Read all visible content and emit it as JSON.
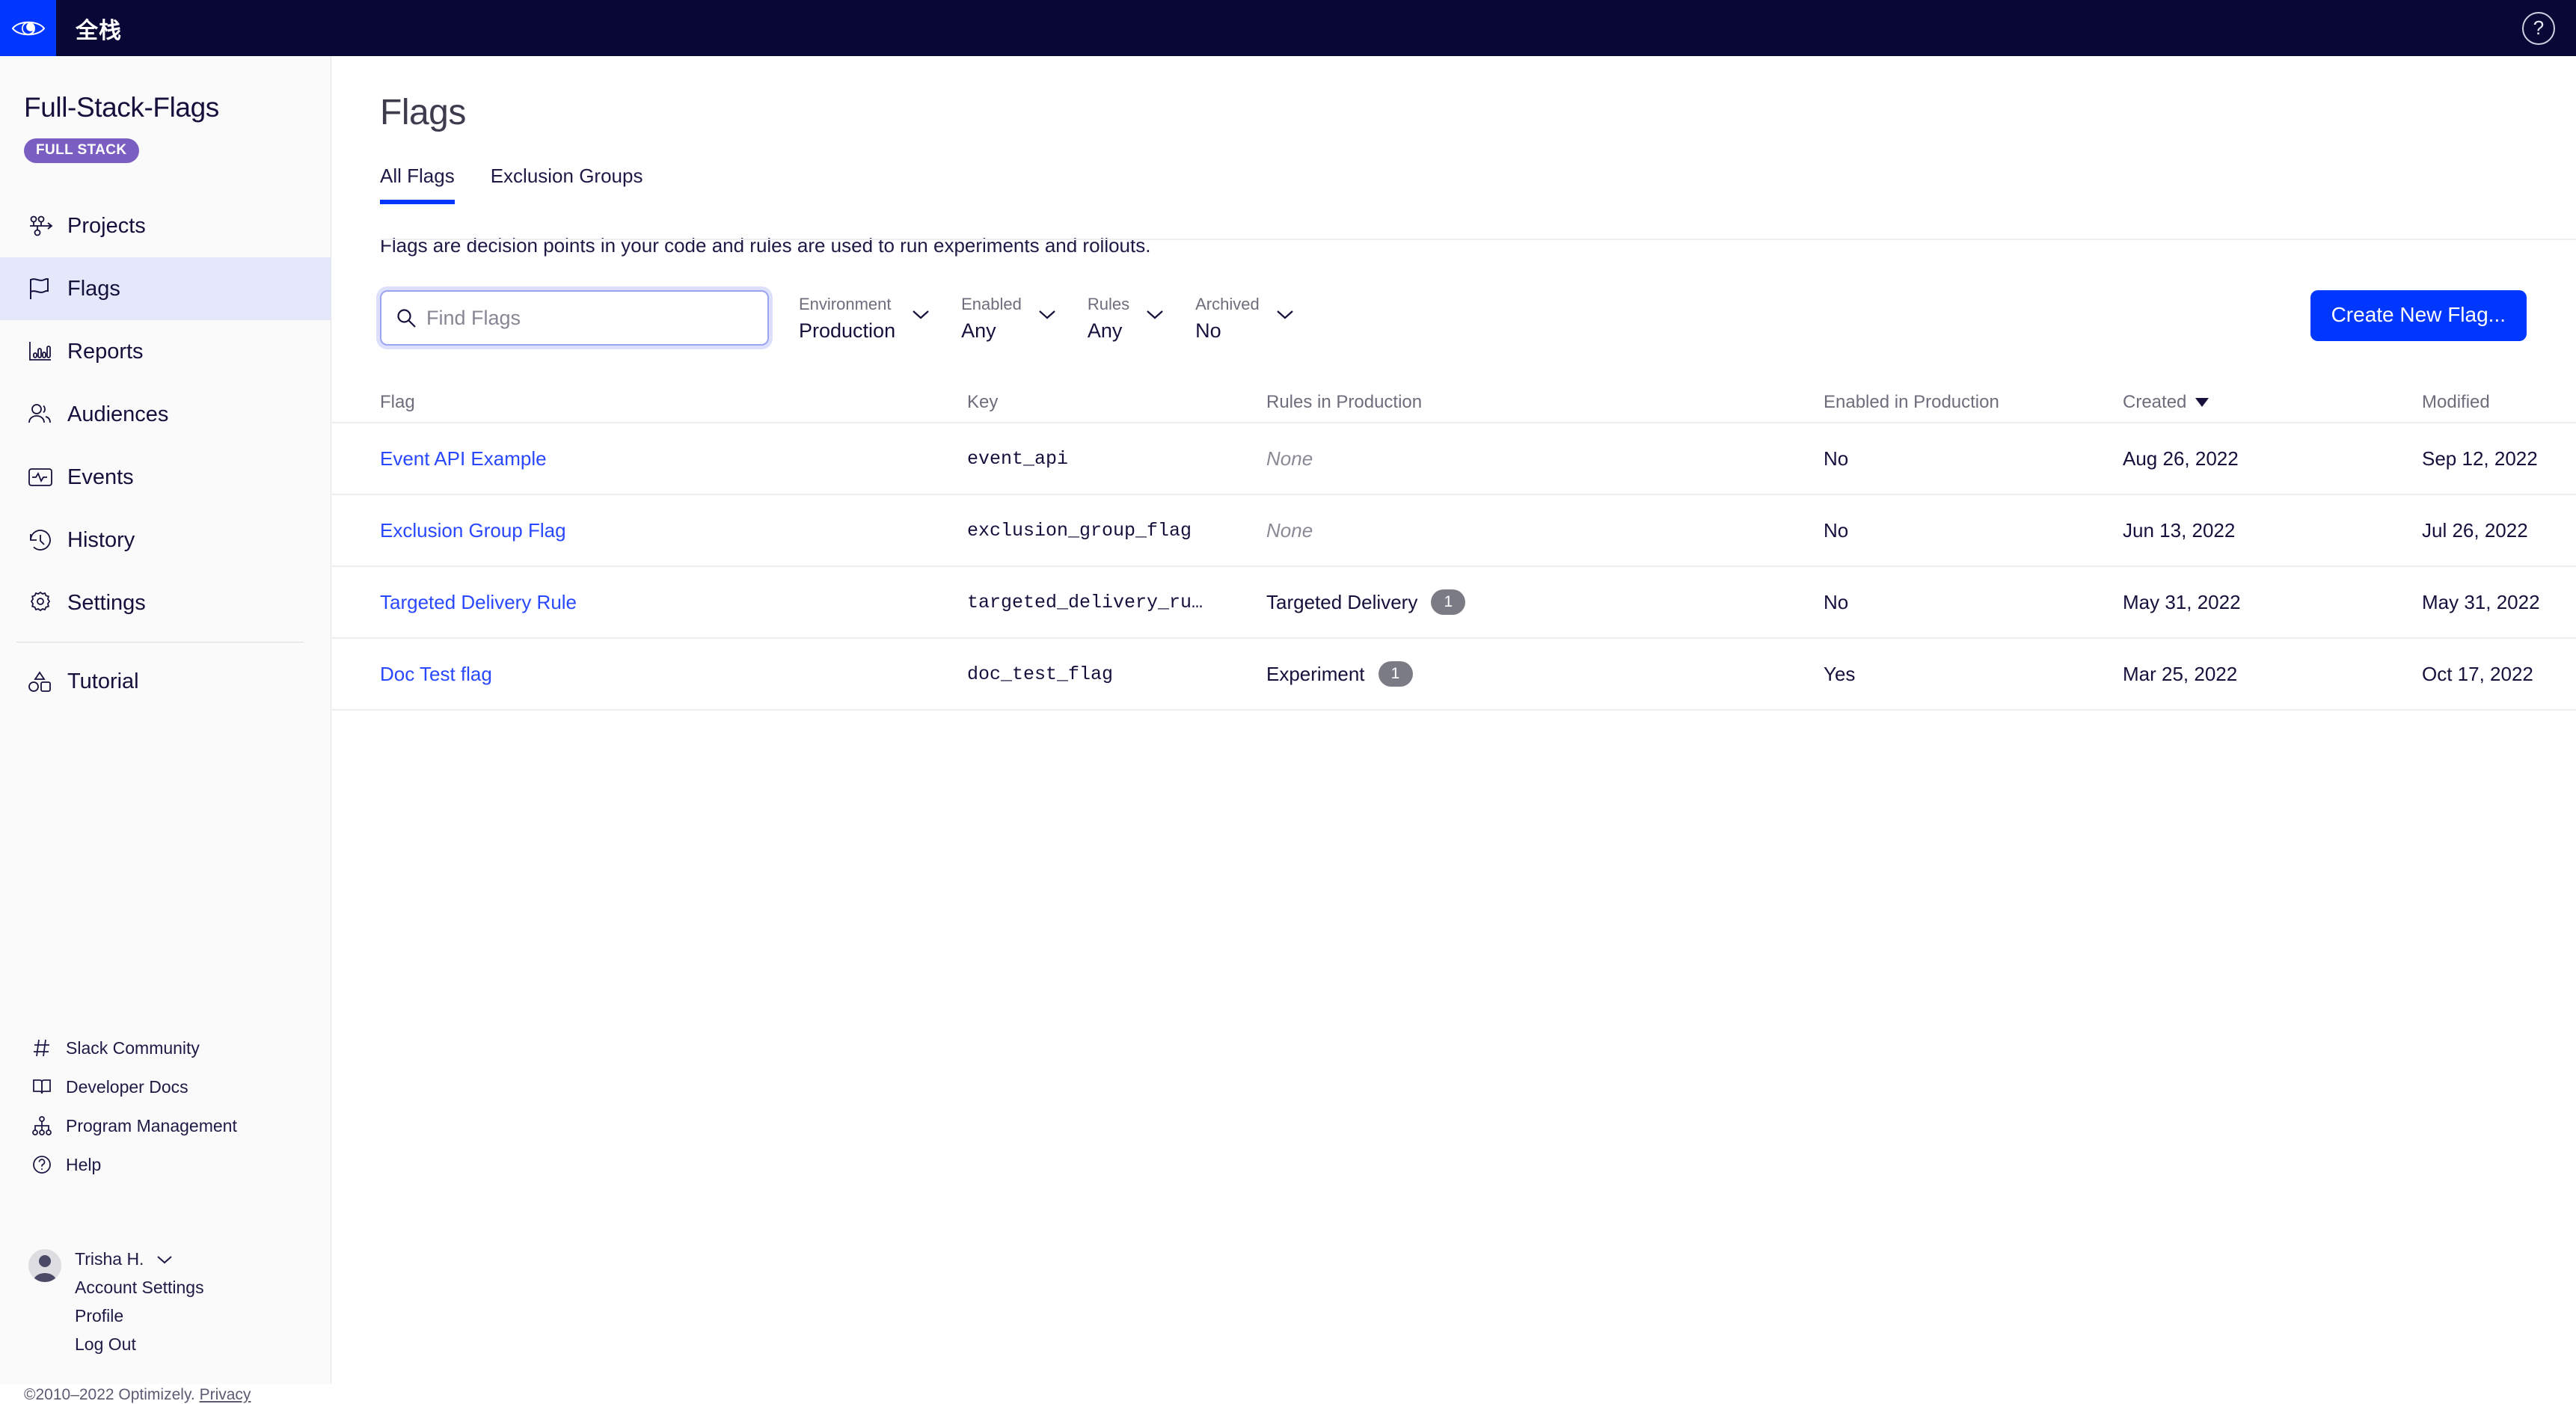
{
  "topbar": {
    "title": "全栈",
    "logo_icon": "optimizely-eye-icon",
    "help_icon": "question-mark-circle-icon",
    "bg_color": "#080736",
    "logo_tile_color": "#0037ff"
  },
  "sidebar": {
    "project_name": "Full-Stack-Flags",
    "project_badge": "FULL STACK",
    "badge_color": "#7b5ec1",
    "nav_items": [
      {
        "label": "Projects",
        "icon": "projects-node-tree-icon",
        "active": false
      },
      {
        "label": "Flags",
        "icon": "flag-icon",
        "active": true
      },
      {
        "label": "Reports",
        "icon": "bar-chart-icon",
        "active": false
      },
      {
        "label": "Audiences",
        "icon": "people-icon",
        "active": false
      },
      {
        "label": "Events",
        "icon": "monitor-pulse-icon",
        "active": false
      },
      {
        "label": "History",
        "icon": "clock-rewind-icon",
        "active": false
      },
      {
        "label": "Settings",
        "icon": "gear-icon",
        "active": false
      },
      {
        "label": "Tutorial",
        "icon": "shapes-icon",
        "active": false
      }
    ],
    "active_bg": "#e5e8fb",
    "footer_items": [
      {
        "label": "Slack Community",
        "icon": "hash-icon"
      },
      {
        "label": "Developer Docs",
        "icon": "book-icon"
      },
      {
        "label": "Program Management",
        "icon": "org-chart-icon"
      },
      {
        "label": "Help",
        "icon": "question-mark-circle-icon"
      }
    ],
    "user": {
      "name": "Trisha H.",
      "avatar_icon": "user-avatar-icon",
      "chevron_icon": "chevron-down-icon",
      "links": [
        "Account Settings",
        "Profile",
        "Log Out"
      ]
    },
    "copyright": "©2010–2022 Optimizely.",
    "privacy_link": "Privacy"
  },
  "main": {
    "page_title": "Flags",
    "tabs": [
      {
        "label": "All Flags",
        "active": true
      },
      {
        "label": "Exclusion Groups",
        "active": false
      }
    ],
    "description": "Flags are decision points in your code and rules are used to run experiments and rollouts.",
    "search": {
      "placeholder": "Find Flags",
      "value": "",
      "icon": "search-icon"
    },
    "filters": [
      {
        "caption": "Environment",
        "value": "Production",
        "icon": "chevron-down-icon"
      },
      {
        "caption": "Enabled",
        "value": "Any",
        "icon": "chevron-down-icon"
      },
      {
        "caption": "Rules",
        "value": "Any",
        "icon": "chevron-down-icon"
      },
      {
        "caption": "Archived",
        "value": "No",
        "icon": "chevron-down-icon"
      }
    ],
    "create_button": "Create New Flag...",
    "accent_color": "#0037ff",
    "link_color": "#2948ff",
    "table": {
      "columns": [
        "Flag",
        "Key",
        "Rules in Production",
        "Enabled in Production",
        "Created",
        "Modified"
      ],
      "sorted_column": "Created",
      "sort_direction": "desc",
      "sort_icon": "caret-down-icon",
      "row_menu_icon": "ellipsis-icon",
      "rows": [
        {
          "flag": "Event API Example",
          "key": "event_api",
          "rules": "None",
          "rules_type": "none",
          "rules_count": "",
          "enabled": "No",
          "created": "Aug 26, 2022",
          "modified": "Sep 12, 2022"
        },
        {
          "flag": "Exclusion Group Flag",
          "key": "exclusion_group_flag",
          "rules": "None",
          "rules_type": "none",
          "rules_count": "",
          "enabled": "No",
          "created": "Jun 13, 2022",
          "modified": "Jul 26, 2022"
        },
        {
          "flag": "Targeted Delivery Rule",
          "key": "targeted_delivery_ru…",
          "rules": "Targeted Delivery",
          "rules_type": "named",
          "rules_count": "1",
          "enabled": "No",
          "created": "May 31, 2022",
          "modified": "May 31, 2022"
        },
        {
          "flag": "Doc Test flag",
          "key": "doc_test_flag",
          "rules": "Experiment",
          "rules_type": "named",
          "rules_count": "1",
          "enabled": "Yes",
          "created": "Mar 25, 2022",
          "modified": "Oct 17, 2022"
        }
      ]
    }
  }
}
